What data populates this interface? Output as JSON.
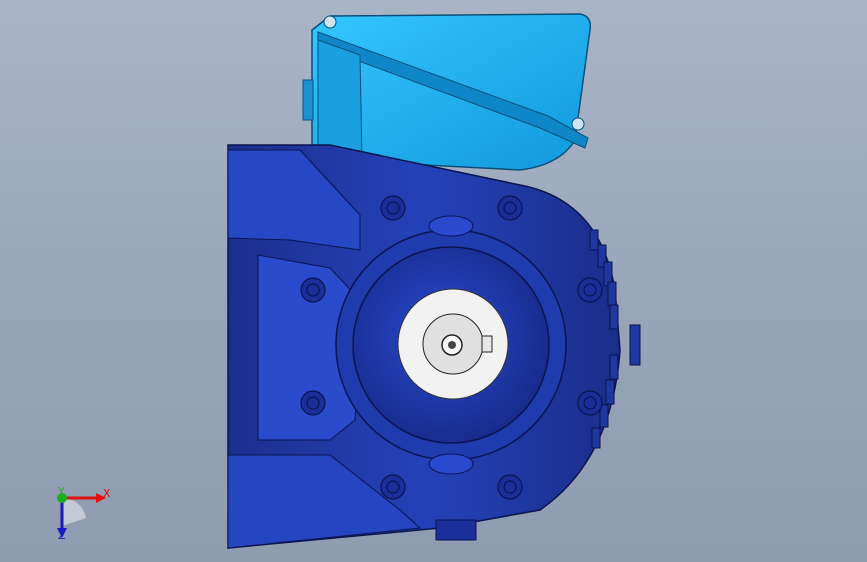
{
  "viewport": {
    "background_top": "#a9b4c6",
    "background_bottom": "#8e9bb0"
  },
  "model": {
    "body_color": "#1d3aa8",
    "body_highlight": "#5a78e8",
    "terminal_box_color": "#19b2ef",
    "shaft_color": "#f2f2f2"
  },
  "triad": {
    "x_label": "X",
    "y_label": "Y",
    "z_label": "Z",
    "x_color": "#e01010",
    "y_color": "#18b018",
    "z_color": "#1a1ac8"
  }
}
